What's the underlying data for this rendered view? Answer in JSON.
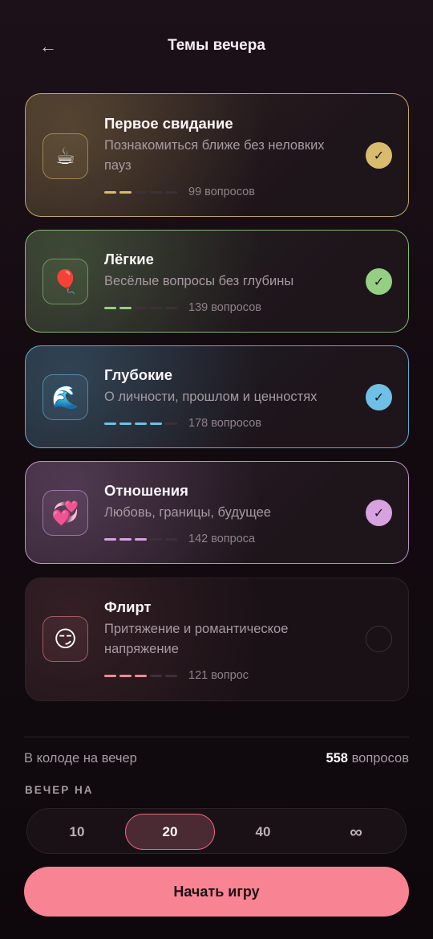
{
  "header": {
    "back_icon": "←",
    "title": "Темы вечера"
  },
  "themes": [
    {
      "title": "Первое свидание",
      "subtitle": "Познакомиться ближе без неловких пауз",
      "emoji": "☕",
      "count": "99 вопросов",
      "selected": true,
      "level": 2,
      "accent": "#d9bb6e",
      "check": "✓"
    },
    {
      "title": "Лёгкие",
      "subtitle": "Весёлые вопросы без глубины",
      "emoji": "🎈",
      "count": "139 вопросов",
      "selected": true,
      "level": 2,
      "accent": "#95cf84",
      "check": "✓"
    },
    {
      "title": "Глубокие",
      "subtitle": "О личности, прошлом и ценностях",
      "emoji": "🌊",
      "count": "178 вопросов",
      "selected": true,
      "level": 4,
      "accent": "#6ec0e6",
      "check": "✓"
    },
    {
      "title": "Отношения",
      "subtitle": "Любовь, границы, будущее",
      "emoji": "💞",
      "count": "142 вопроса",
      "selected": true,
      "level": 3,
      "accent": "#d7a2e0",
      "check": "✓"
    },
    {
      "title": "Флирт",
      "subtitle": "Притяжение и романтическое напряжение",
      "emoji": "😏",
      "count": "121 вопрос",
      "selected": false,
      "level": 3,
      "accent": "#f08a96",
      "check": ""
    }
  ],
  "deck": {
    "label": "В колоде на вечер",
    "count": "558",
    "unit": "вопросов"
  },
  "evening": {
    "label": "ВЕЧЕР НА",
    "options": [
      "10",
      "20",
      "40",
      "∞"
    ],
    "selected_index": 1
  },
  "start_label": "Начать игру"
}
